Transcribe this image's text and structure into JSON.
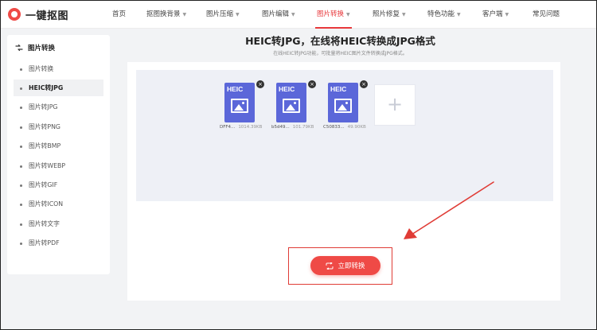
{
  "brand": {
    "name": "一键抠图",
    "color": "#ef4a46"
  },
  "nav": {
    "items": [
      {
        "label": "首页",
        "dropdown": false
      },
      {
        "label": "抠图换背景",
        "dropdown": true
      },
      {
        "label": "图片压缩",
        "dropdown": true
      },
      {
        "label": "图片编辑",
        "dropdown": true
      },
      {
        "label": "图片转换",
        "dropdown": true,
        "active": true
      },
      {
        "label": "照片修复",
        "dropdown": true
      },
      {
        "label": "特色功能",
        "dropdown": true
      },
      {
        "label": "客户端",
        "dropdown": true
      },
      {
        "label": "常见问题",
        "dropdown": false
      }
    ],
    "caret": "▼"
  },
  "sidebar": {
    "title": "图片转换",
    "items": [
      {
        "label": "图片转换"
      },
      {
        "label": "HEIC转JPG",
        "active": true
      },
      {
        "label": "图片转JPG"
      },
      {
        "label": "图片转PNG"
      },
      {
        "label": "图片转BMP"
      },
      {
        "label": "图片转WEBP"
      },
      {
        "label": "图片转GIF"
      },
      {
        "label": "图片转ICON"
      },
      {
        "label": "图片转文字"
      },
      {
        "label": "图片转PDF"
      }
    ]
  },
  "main": {
    "title": "HEIC转JPG，在线将HEIC转换成JPG格式",
    "subtitle": "在线HEIC转JPG功能，可批量将HEIC图片文件转换成JPG格式。",
    "files": [
      {
        "type_tag": "HEIC",
        "name": "DFF4...",
        "size": "1014.39KB"
      },
      {
        "type_tag": "HEIC",
        "name": "b5d49...",
        "size": "101.79KB"
      },
      {
        "type_tag": "HEIC",
        "name": "C50833...",
        "size": "49.90KB"
      }
    ],
    "delete_glyph": "×",
    "add_glyph": "+",
    "convert_button": "立即转换"
  },
  "colors": {
    "accent": "#e8393c",
    "file_icon": "#5b67d9",
    "upload_bg": "#eef0f6"
  },
  "icons": [
    "logo-icon",
    "sidebar-convert-icon",
    "heic-file-icon",
    "image-icon",
    "close-icon",
    "plus-icon",
    "refresh-icon",
    "annotation-arrow"
  ]
}
